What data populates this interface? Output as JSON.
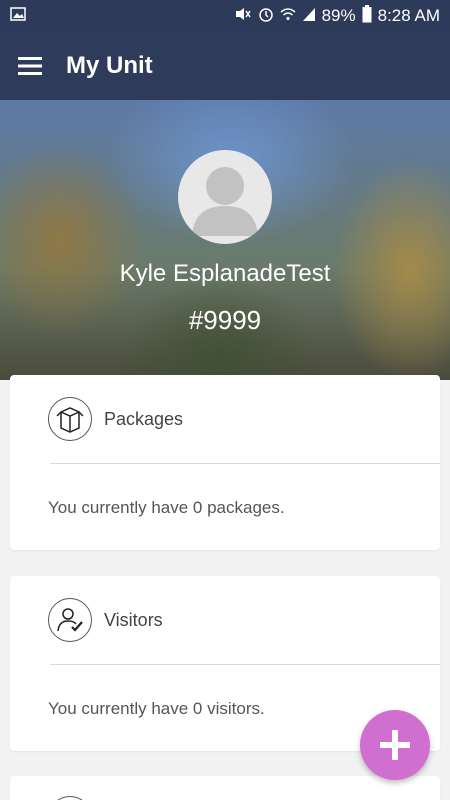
{
  "status_bar": {
    "battery": "89%",
    "time": "8:28 AM"
  },
  "app_bar": {
    "title": "My Unit"
  },
  "profile": {
    "name": "Kyle EsplanadeTest",
    "unit": "#9999"
  },
  "cards": [
    {
      "title": "Packages",
      "message": "You currently have 0 packages.",
      "icon": "package-icon"
    },
    {
      "title": "Visitors",
      "message": "You currently have 0 visitors.",
      "icon": "visitor-icon"
    }
  ],
  "colors": {
    "app_bar": "#2f3b5a",
    "fab": "#d06fd0"
  }
}
